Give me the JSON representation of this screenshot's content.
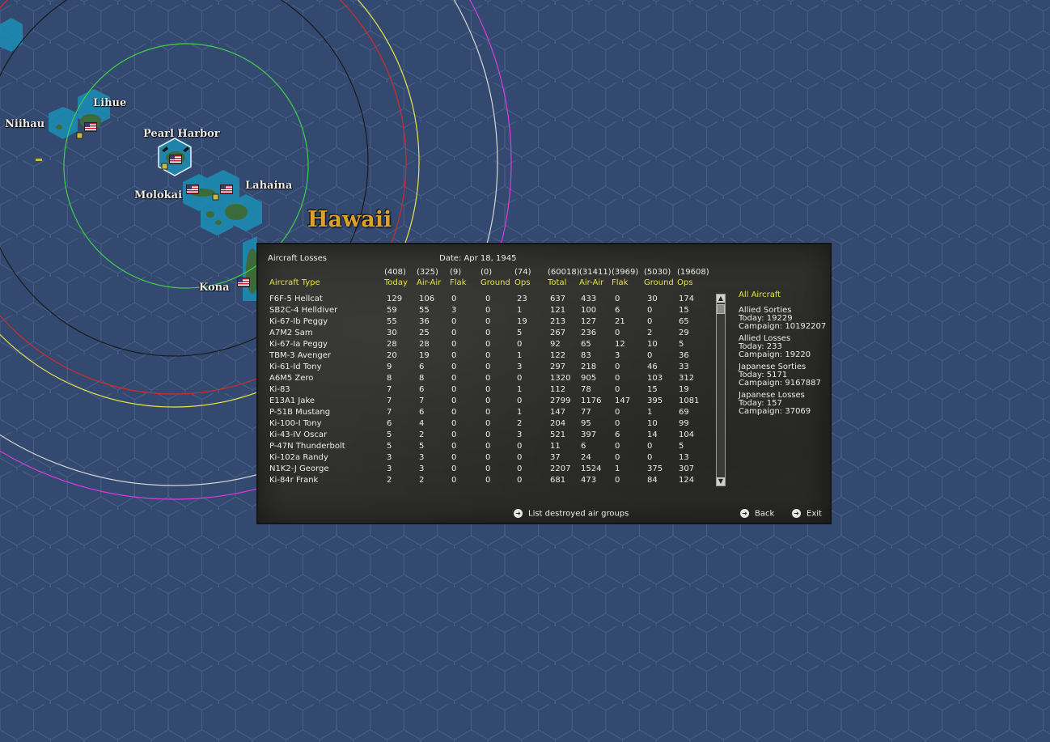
{
  "map": {
    "region_label": "Hawaii",
    "places": [
      "Lihue",
      "Niihau",
      "Pearl Harbor",
      "Molokai",
      "Lahaina",
      "Kona"
    ],
    "colors": {
      "sea": "#34496f",
      "hex_grid": "#4a5f86",
      "land": "#3d6a3a"
    }
  },
  "panel": {
    "title": "Aircraft Losses",
    "date": "Date: Apr 18, 1945",
    "columns": [
      {
        "total": "(408)",
        "label": "Today"
      },
      {
        "total": "(325)",
        "label": "Air-Air"
      },
      {
        "total": "(9)",
        "label": "Flak"
      },
      {
        "total": "(0)",
        "label": "Ground"
      },
      {
        "total": "(74)",
        "label": "Ops"
      },
      {
        "total": "(60018)",
        "label": "Total"
      },
      {
        "total": "(31411)",
        "label": "Air-Air"
      },
      {
        "total": "(3969)",
        "label": "Flak"
      },
      {
        "total": "(5030)",
        "label": "Ground"
      },
      {
        "total": "(19608)",
        "label": "Ops"
      }
    ],
    "type_header": "Aircraft Type",
    "rows": [
      {
        "name": "F6F-5 Hellcat",
        "v": [
          "129",
          "106",
          "0",
          "0",
          "23",
          "637",
          "433",
          "0",
          "30",
          "174"
        ]
      },
      {
        "name": "SB2C-4 Helldiver",
        "v": [
          "59",
          "55",
          "3",
          "0",
          "1",
          "121",
          "100",
          "6",
          "0",
          "15"
        ]
      },
      {
        "name": "Ki-67-Ib Peggy",
        "v": [
          "55",
          "36",
          "0",
          "0",
          "19",
          "213",
          "127",
          "21",
          "0",
          "65"
        ]
      },
      {
        "name": "A7M2 Sam",
        "v": [
          "30",
          "25",
          "0",
          "0",
          "5",
          "267",
          "236",
          "0",
          "2",
          "29"
        ]
      },
      {
        "name": "Ki-67-Ia Peggy",
        "v": [
          "28",
          "28",
          "0",
          "0",
          "0",
          "92",
          "65",
          "12",
          "10",
          "5"
        ]
      },
      {
        "name": "TBM-3 Avenger",
        "v": [
          "20",
          "19",
          "0",
          "0",
          "1",
          "122",
          "83",
          "3",
          "0",
          "36"
        ]
      },
      {
        "name": "Ki-61-Id Tony",
        "v": [
          "9",
          "6",
          "0",
          "0",
          "3",
          "297",
          "218",
          "0",
          "46",
          "33"
        ]
      },
      {
        "name": "A6M5 Zero",
        "v": [
          "8",
          "8",
          "0",
          "0",
          "0",
          "1320",
          "905",
          "0",
          "103",
          "312"
        ]
      },
      {
        "name": "Ki-83",
        "v": [
          "7",
          "6",
          "0",
          "0",
          "1",
          "112",
          "78",
          "0",
          "15",
          "19"
        ]
      },
      {
        "name": "E13A1 Jake",
        "v": [
          "7",
          "7",
          "0",
          "0",
          "0",
          "2799",
          "1176",
          "147",
          "395",
          "1081"
        ]
      },
      {
        "name": "P-51B Mustang",
        "v": [
          "7",
          "6",
          "0",
          "0",
          "1",
          "147",
          "77",
          "0",
          "1",
          "69"
        ]
      },
      {
        "name": "Ki-100-I Tony",
        "v": [
          "6",
          "4",
          "0",
          "0",
          "2",
          "204",
          "95",
          "0",
          "10",
          "99"
        ]
      },
      {
        "name": "Ki-43-IV Oscar",
        "v": [
          "5",
          "2",
          "0",
          "0",
          "3",
          "521",
          "397",
          "6",
          "14",
          "104"
        ]
      },
      {
        "name": "P-47N Thunderbolt",
        "v": [
          "5",
          "5",
          "0",
          "0",
          "0",
          "11",
          "6",
          "0",
          "0",
          "5"
        ]
      },
      {
        "name": "Ki-102a Randy",
        "v": [
          "3",
          "3",
          "0",
          "0",
          "0",
          "37",
          "24",
          "0",
          "0",
          "13"
        ]
      },
      {
        "name": "N1K2-J George",
        "v": [
          "3",
          "3",
          "0",
          "0",
          "0",
          "2207",
          "1524",
          "1",
          "375",
          "307"
        ]
      },
      {
        "name": "Ki-84r Frank",
        "v": [
          "2",
          "2",
          "0",
          "0",
          "0",
          "681",
          "473",
          "0",
          "84",
          "124"
        ]
      }
    ],
    "sidebar": {
      "filter": "All Aircraft",
      "allied_sorties": {
        "title": "Allied Sorties",
        "today": "Today:  19229",
        "campaign": "Campaign: 10192207"
      },
      "allied_losses": {
        "title": "Allied Losses",
        "today": "Today:  233",
        "campaign": "Campaign: 19220"
      },
      "japanese_sorties": {
        "title": "Japanese Sorties",
        "today": "Today:  5171",
        "campaign": "Campaign: 9167887"
      },
      "japanese_losses": {
        "title": "Japanese Losses",
        "today": "Today:  157",
        "campaign": "Campaign: 37069"
      }
    },
    "buttons": {
      "list_destroyed": "List destroyed air groups",
      "back": "Back",
      "exit": "Exit"
    }
  }
}
